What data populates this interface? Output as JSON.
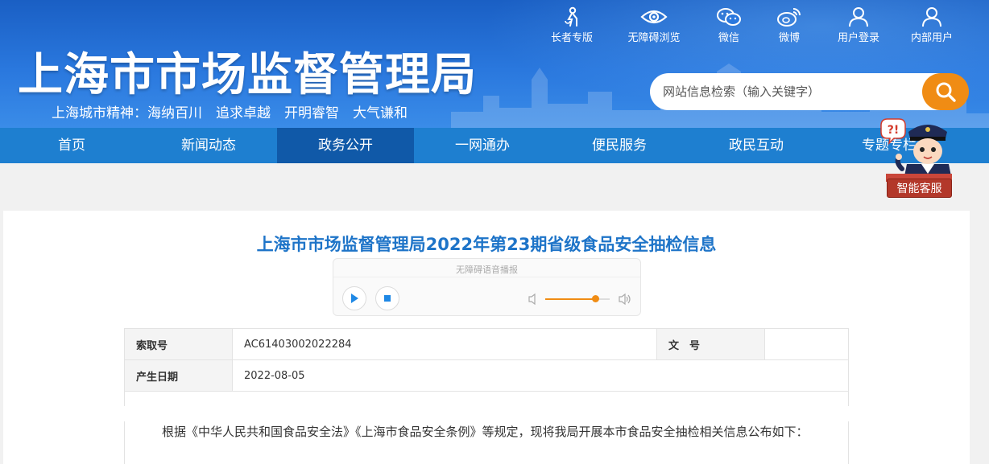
{
  "header": {
    "site_title": "上海市市场监督管理局",
    "slogan": "上海城市精神：海纳百川　追求卓越　开明睿智　大气谦和",
    "tools": [
      {
        "label": "长者专版",
        "icon": "elderly-icon"
      },
      {
        "label": "无障碍浏览",
        "icon": "eye-icon"
      },
      {
        "label": "微信",
        "icon": "wechat-icon"
      },
      {
        "label": "微博",
        "icon": "weibo-icon"
      },
      {
        "label": "用户登录",
        "icon": "user-icon"
      },
      {
        "label": "内部用户",
        "icon": "internal-user-icon"
      }
    ],
    "search": {
      "placeholder": "网站信息检索（输入关键字）"
    }
  },
  "nav": {
    "items": [
      {
        "label": "首页"
      },
      {
        "label": "新闻动态"
      },
      {
        "label": "政务公开",
        "active": true
      },
      {
        "label": "一网通办"
      },
      {
        "label": "便民服务"
      },
      {
        "label": "政民互动"
      },
      {
        "label": "专题专栏"
      }
    ]
  },
  "assistant": {
    "label": "智能客服"
  },
  "article": {
    "title": "上海市市场监督管理局2022年第23期省级食品安全抽检信息",
    "player": {
      "label": "无障碍语音播报",
      "volume": 0.78
    },
    "meta": {
      "index_label": "索取号",
      "index_value": "AC61403002022284",
      "doc_no_label": "文　号",
      "doc_no_value": "",
      "date_label": "产生日期",
      "date_value": "2022-08-05"
    },
    "paragraph": "根据《中华人民共和国食品安全法》《上海市食品安全条例》等规定，现将我局开展本市食品安全抽检相关信息公布如下："
  },
  "colors": {
    "header_blue": "#2a78de",
    "nav_blue": "#1e7fd0",
    "nav_active": "#1059a8",
    "title_blue": "#1e74c8",
    "accent_orange": "#f08c14"
  }
}
